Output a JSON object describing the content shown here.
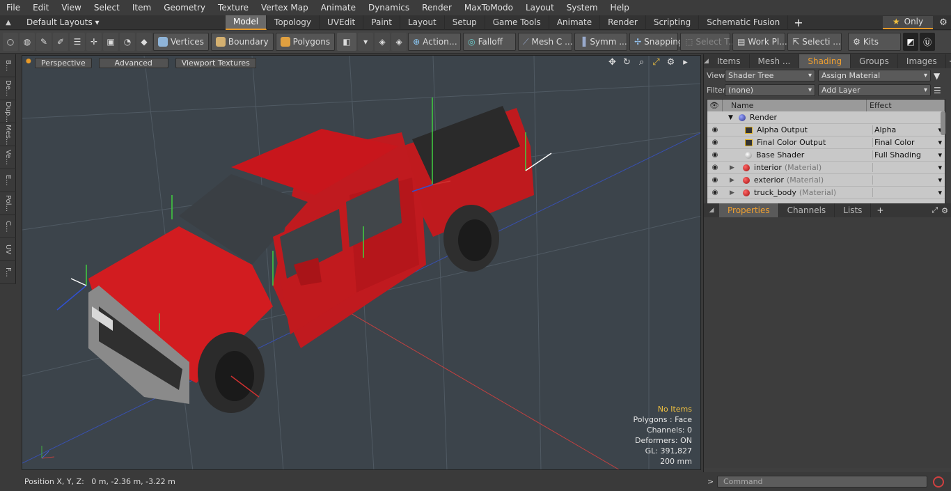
{
  "menu": [
    "File",
    "Edit",
    "View",
    "Select",
    "Item",
    "Geometry",
    "Texture",
    "Vertex Map",
    "Animate",
    "Dynamics",
    "Render",
    "MaxToModo",
    "Layout",
    "System",
    "Help"
  ],
  "layoutbar": {
    "layouts_label": "Default Layouts",
    "tabs": [
      "Model",
      "Topology",
      "UVEdit",
      "Paint",
      "Layout",
      "Setup",
      "Game Tools",
      "Animate",
      "Render",
      "Scripting",
      "Schematic Fusion"
    ],
    "active_tab": "Model",
    "only_label": "Only"
  },
  "toolbar": {
    "vertices": "Vertices",
    "boundary": "Boundary",
    "polygons": "Polygons",
    "action": "Action",
    "falloff": "Falloff",
    "mesh": "Mesh C ...",
    "symm": "Symm ...",
    "snapping": "Snapping",
    "select_t": "Select T...",
    "work_pl": "Work Pl...",
    "selecti": "Selecti ...",
    "kits": "Kits"
  },
  "leftstrip": [
    "B...",
    "De...",
    "Dup...",
    "Mes...",
    "Ve...",
    "E...",
    "Pol...",
    "C...",
    "UV",
    "F..."
  ],
  "viewport": {
    "perspective": "Perspective",
    "advanced": "Advanced",
    "viewport_textures": "Viewport Textures",
    "info": {
      "no_items": "No Items",
      "polygons": "Polygons : Face",
      "channels": "Channels: 0",
      "deformers": "Deformers: ON",
      "gl": "GL: 391,827",
      "scale": "200 mm"
    }
  },
  "status": {
    "position": "Position X, Y, Z:   0 m, -2.36 m, -3.22 m"
  },
  "rightpanel": {
    "tabs": [
      "Items",
      "Mesh ...",
      "Shading",
      "Groups",
      "Images"
    ],
    "active_tab": "Shading",
    "view_label": "View",
    "view_value": "Shader Tree",
    "assign_material": "Assign Material",
    "filter_label": "Filter",
    "filter_value": "(none)",
    "add_layer": "Add Layer",
    "columns": {
      "name": "Name",
      "effect": "Effect"
    },
    "rows": [
      {
        "name": "Render",
        "sub": "",
        "effect": "",
        "icon": "render"
      },
      {
        "name": "Alpha Output",
        "sub": "",
        "effect": "Alpha",
        "icon": "image"
      },
      {
        "name": "Final Color Output",
        "sub": "",
        "effect": "Final Color",
        "icon": "image"
      },
      {
        "name": "Base Shader",
        "sub": "",
        "effect": "Full Shading",
        "icon": "shader"
      },
      {
        "name": "interior",
        "sub": "(Material)",
        "effect": "",
        "icon": "material"
      },
      {
        "name": "exterior",
        "sub": "(Material)",
        "effect": "",
        "icon": "material"
      },
      {
        "name": "truck_body",
        "sub": "(Material)",
        "effect": "",
        "icon": "material"
      }
    ],
    "bottom_tabs": [
      "Properties",
      "Channels",
      "Lists"
    ],
    "bottom_active": "Properties"
  },
  "command": {
    "placeholder": "Command"
  },
  "colors": {
    "accent": "#e89a28",
    "viewport_bg": "#3c444b",
    "truck_red": "#c8161c"
  }
}
